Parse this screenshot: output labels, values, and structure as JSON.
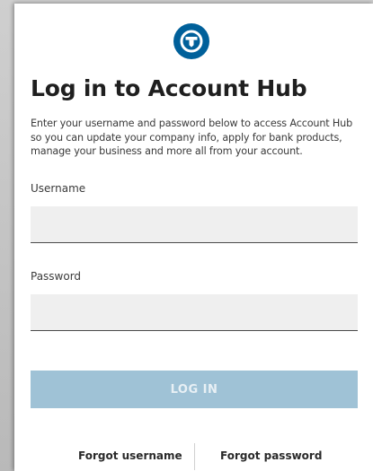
{
  "brand": {
    "logo_icon": "account-hub-logo-icon",
    "color": "#00609a"
  },
  "login": {
    "title": "Log in to Account Hub",
    "description": "Enter your username and password below to access Account Hub so you can update your company info, apply for bank products, manage your business and more all from your account.",
    "username_label": "Username",
    "username_value": "",
    "password_label": "Password",
    "password_value": "",
    "submit_label": "LOG IN",
    "submit_color": "#9fc2d6",
    "forgot_username": "Forgot username",
    "forgot_password": "Forgot password"
  }
}
